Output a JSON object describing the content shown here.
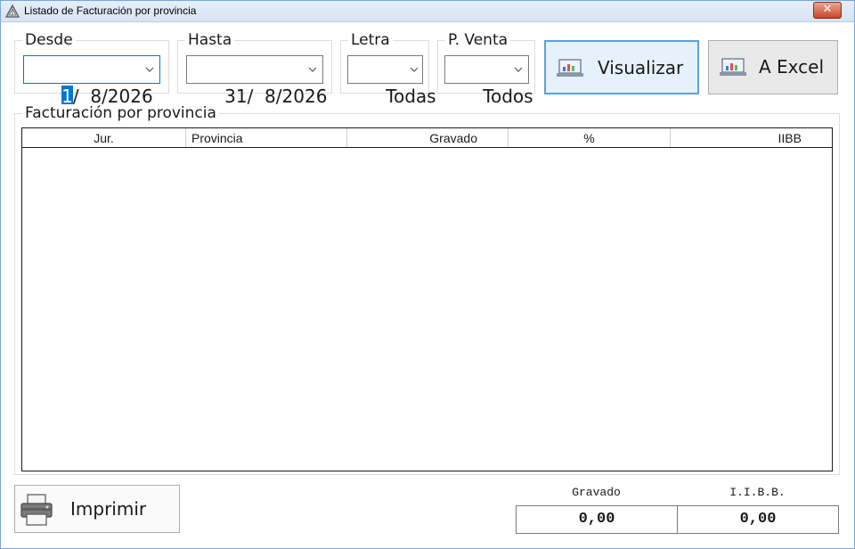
{
  "window": {
    "title": "Listado de Facturación por provincia",
    "close_label": "✕"
  },
  "filters": {
    "desde": {
      "label": "Desde",
      "value_selected": "1",
      "value_rest": "/  8/2026"
    },
    "hasta": {
      "label": "Hasta",
      "value": "31/  8/2026"
    },
    "letra": {
      "label": "Letra",
      "value": "Todas"
    },
    "pventa": {
      "label": "P. Venta",
      "value": "Todos"
    }
  },
  "buttons": {
    "visualizar": "Visualizar",
    "excel": "A Excel",
    "imprimir": "Imprimir"
  },
  "table": {
    "group_label": "Facturación por provincia",
    "columns": [
      "Jur.",
      "Provincia",
      "Gravado",
      "%",
      "IIBB"
    ],
    "rows": []
  },
  "totals": {
    "gravado_label": "Gravado",
    "gravado_value": "0,00",
    "iibb_label": "I.I.B.B.",
    "iibb_value": "0,00"
  },
  "colors": {
    "accent": "#0078d7",
    "close": "#c7472b"
  }
}
